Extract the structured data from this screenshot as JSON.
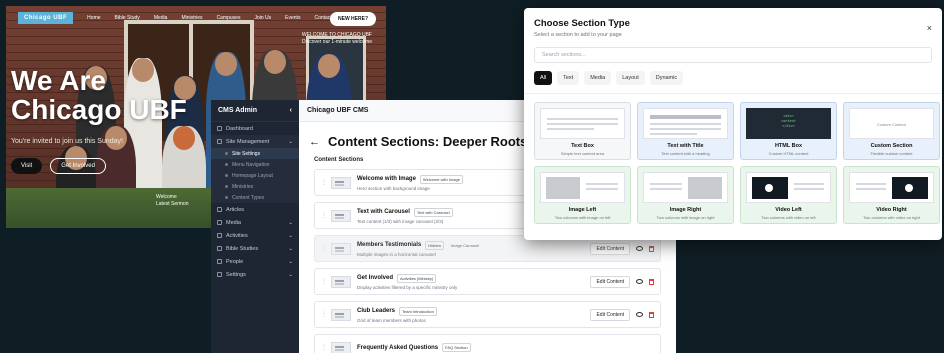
{
  "website": {
    "logo": "Chicago UBF",
    "nav": [
      "Home",
      "Bible Study",
      "Media",
      "Ministries",
      "Campuses",
      "Join Us",
      "Events",
      "Contact Us"
    ],
    "new_here": "NEW HERE?",
    "tagline_1": "WELCOME TO CHICAGO UBF",
    "tagline_2": "Discover our 1-minute welcome",
    "hero_title_1": "We Are",
    "hero_title_2": "Chicago UBF",
    "hero_sub": "You're invited to join us this Sunday!",
    "btn_visit": "Visit",
    "btn_get_involved": "Get Involved",
    "corner_1": "Welcome",
    "corner_2": "Latest Sermon"
  },
  "cms": {
    "title": "CMS Admin",
    "collapse_icon": "chevron-left",
    "items": [
      {
        "label": "Dashboard"
      },
      {
        "label": "Site Management",
        "open": true,
        "children": [
          "Site Settings",
          "Menu Navigation",
          "Homepage Layout",
          "Ministries",
          "Content Types"
        ]
      },
      {
        "label": "Articles"
      },
      {
        "label": "Media",
        "caret": true
      },
      {
        "label": "Activities",
        "caret": true
      },
      {
        "label": "Bible Studies",
        "caret": true
      },
      {
        "label": "People",
        "caret": true
      },
      {
        "label": "Settings",
        "caret": true
      }
    ]
  },
  "panel": {
    "header": "Chicago UBF CMS",
    "title": "Content Sections: Deeper Roots In Christ",
    "section_label": "Content Sections",
    "rows": [
      {
        "name": "Welcome with Image",
        "tag": "Welcome with Image",
        "desc": "Hero section with background image",
        "faded": false,
        "edit": ""
      },
      {
        "name": "Text with Carousel",
        "tag": "Text with Carousel",
        "desc": "Text content (1/3) with image carousel (2/3)",
        "faded": false,
        "edit": ""
      },
      {
        "name": "Members Testimonials",
        "tag": "Hidden",
        "tag2": "Image Carousel",
        "desc": "Multiple images in a horizontal carousel",
        "faded": true,
        "edit": "Edit Content"
      },
      {
        "name": "Get Involved",
        "tag": "Activities (Ministry)",
        "desc": "Display activities filtered by a specific ministry only",
        "faded": false,
        "edit": "Edit Content"
      },
      {
        "name": "Club Leaders",
        "tag": "Team Introduction",
        "desc": "Grid of team members with photos",
        "faded": false,
        "edit": "Edit Content"
      },
      {
        "name": "Frequently Asked Questions",
        "tag": "FAQ Section",
        "desc": "",
        "faded": false,
        "edit": ""
      }
    ]
  },
  "modal": {
    "title": "Choose Section Type",
    "subtitle": "Select a section to add to your page",
    "close": "×",
    "search_placeholder": "Search sections...",
    "filters": [
      "All",
      "Text",
      "Media",
      "Layout",
      "Dynamic"
    ],
    "active_filter": "All",
    "cards_row1": [
      {
        "title": "Text Box",
        "desc": "Simple text content area",
        "style": "plain"
      },
      {
        "title": "Text with Title",
        "desc": "Text content with a heading",
        "style": "blue"
      },
      {
        "title": "HTML Box",
        "desc": "Custom HTML content",
        "style": "blue"
      },
      {
        "title": "Custom Section",
        "desc": "Flexible custom content",
        "style": "blue",
        "preview_text": "Custom Content"
      }
    ],
    "cards_row2": [
      {
        "title": "Image Left",
        "desc": "Two columns with image on left",
        "style": "green"
      },
      {
        "title": "Image Right",
        "desc": "Two columns with image on right",
        "style": "green"
      },
      {
        "title": "Video Left",
        "desc": "Two columns with video on left",
        "style": "green"
      },
      {
        "title": "Video Right",
        "desc": "Two columns with video on right",
        "style": "green"
      }
    ],
    "html_preview": [
      "<div>",
      "content",
      "</div>"
    ]
  }
}
